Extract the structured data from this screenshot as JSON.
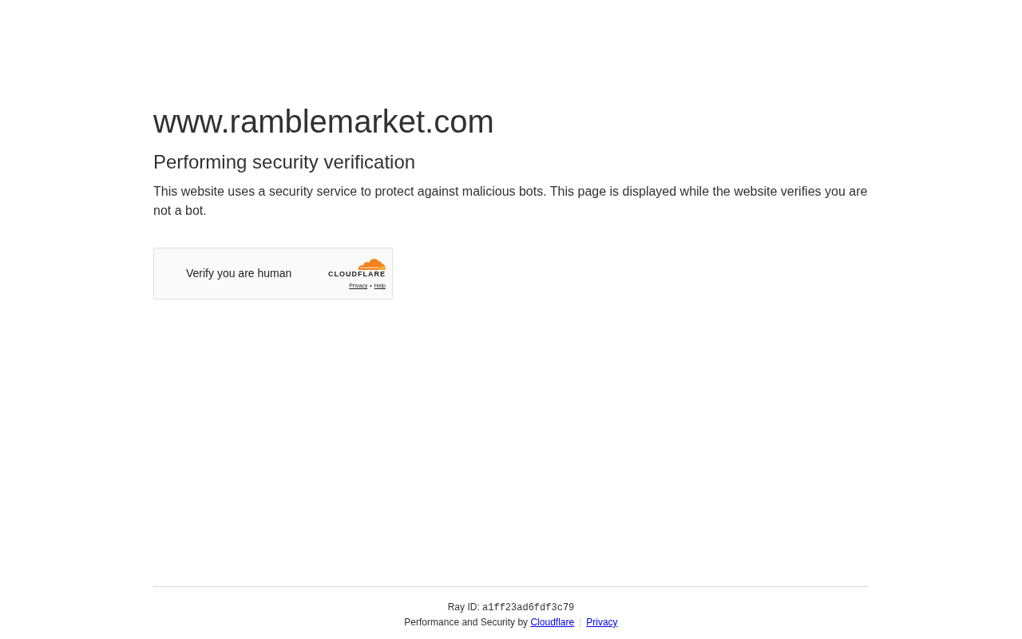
{
  "site_title": "www.ramblemarket.com",
  "heading": "Performing security verification",
  "description": "This website uses a security service to protect against malicious bots. This page is displayed while the website verifies you are not a bot.",
  "challenge": {
    "label": "Verify you are human",
    "brand": "CLOUDFLARE",
    "links": [
      "Privacy",
      "Help"
    ],
    "separator": "•"
  },
  "footer": {
    "ray_label": "Ray ID:",
    "ray_id": "a1ff23ad6fdf3c79",
    "attribution": "Performance and Security by",
    "links": [
      "Cloudflare",
      "Privacy"
    ],
    "separator": "|"
  }
}
